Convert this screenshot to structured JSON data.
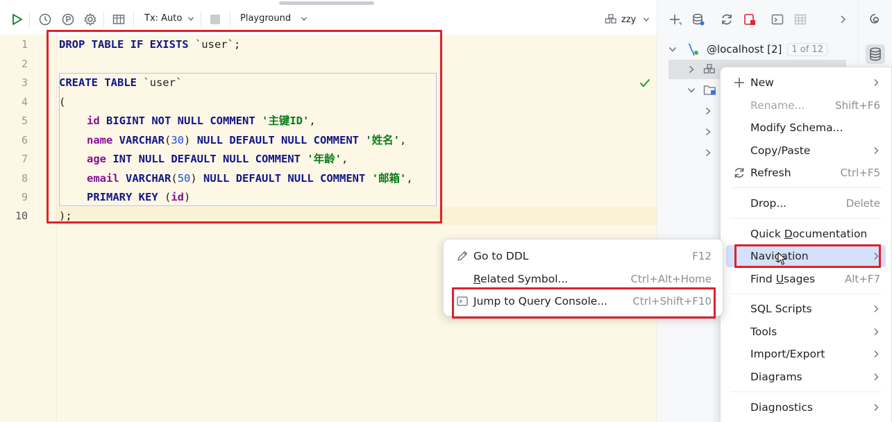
{
  "toolbar": {
    "tx_mode": "Tx: Auto",
    "playground": "Playground",
    "datasource": "zzy"
  },
  "editor": {
    "line_numbers": [
      "1",
      "2",
      "3",
      "4",
      "5",
      "6",
      "7",
      "8",
      "9",
      "10"
    ],
    "lines": {
      "l1": {
        "kw": "DROP TABLE IF EXISTS",
        "rest": " `user`;"
      },
      "l3": {
        "kw": "CREATE TABLE",
        "rest": " `user`"
      },
      "l4": "(",
      "l5": {
        "col": "id",
        "t1": "BIGINT NOT NULL COMMENT",
        "str": "'主键ID'",
        "end": ","
      },
      "l6": {
        "col": "name",
        "t1": "VARCHAR",
        "p1": "(",
        "n": "30",
        "p2": ")",
        "t2": "NULL DEFAULT NULL COMMENT",
        "str": "'姓名'",
        "end": ","
      },
      "l7": {
        "col": "age",
        "t1": "INT NULL DEFAULT NULL COMMENT",
        "str": "'年龄'",
        "end": ","
      },
      "l8": {
        "col": "email",
        "t1": "VARCHAR",
        "p1": "(",
        "n": "50",
        "p2": ")",
        "t2": "NULL DEFAULT NULL COMMENT",
        "str": "'邮箱'",
        "end": ","
      },
      "l9": {
        "kw": "PRIMARY KEY",
        "p1": " (",
        "col": "id",
        "p2": ")"
      },
      "l10": ");"
    }
  },
  "database_panel": {
    "host": "@localhost [2]",
    "badge": "1 of 12"
  },
  "context_menu": {
    "items": {
      "new": "New",
      "rename": "Rename...",
      "rename_sc": "Shift+F6",
      "modify": "Modify Schema...",
      "copy": "Copy/Paste",
      "refresh": "Refresh",
      "refresh_sc": "Ctrl+F5",
      "drop": "Drop...",
      "drop_sc": "Delete",
      "quickdoc_pre": "Quick ",
      "quickdoc_u": "D",
      "quickdoc_post": "ocumentation",
      "nav": "Navigation",
      "find_pre": "Find ",
      "find_u": "U",
      "find_post": "sages",
      "find_sc": "Alt+F7",
      "scripts": "SQL Scripts",
      "tools": "Tools",
      "impexp": "Import/Export",
      "diagrams": "Diagrams",
      "diagnostics": "Diagnostics"
    }
  },
  "submenu": {
    "ddl": "Go to DDL",
    "ddl_sc": "F12",
    "related_u": "R",
    "related_post": "elated Symbol...",
    "related_sc": "Ctrl+Alt+Home",
    "jump": "Jump to Query Console...",
    "jump_sc": "Ctrl+Shift+F10"
  },
  "colors": {
    "keyword": "#101686",
    "column": "#871094",
    "string": "#067d17",
    "number": "#1750eb",
    "editor_bg": "#fdf7e6",
    "highlight": "#e0202a",
    "menu_selection": "#d5e1fb"
  },
  "icons": [
    "run-icon",
    "history-icon",
    "parameters-icon",
    "settings-icon",
    "table-view-icon",
    "stop-icon",
    "schema-icon",
    "add-icon",
    "datasource-icon",
    "refresh-icon",
    "jump-icon",
    "console-icon",
    "grid-icon",
    "more-icon",
    "ai-icon",
    "database-icon",
    "host-icon",
    "schema-tree-icon",
    "folder-icon",
    "edit-icon",
    "refresh-menu-icon",
    "plus-icon",
    "console-menu-icon",
    "checkmark-icon",
    "cursor-icon"
  ]
}
